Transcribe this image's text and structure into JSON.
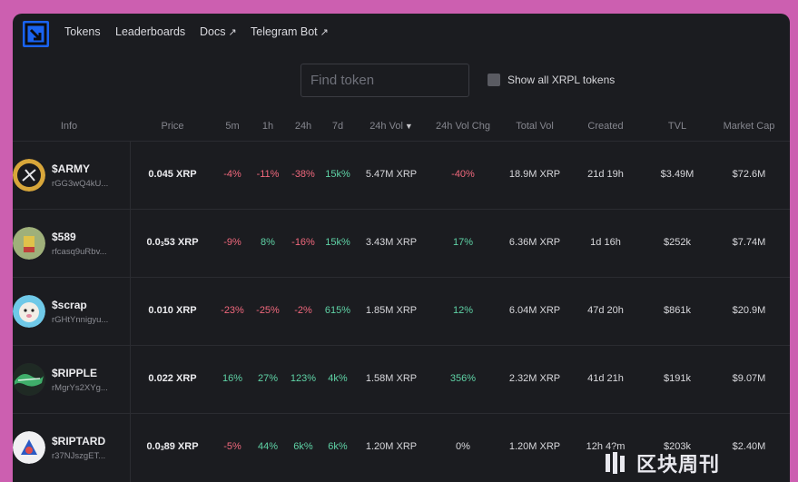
{
  "nav": {
    "items": [
      {
        "label": "Tokens",
        "external": false
      },
      {
        "label": "Leaderboards",
        "external": false
      },
      {
        "label": "Docs",
        "external": true
      },
      {
        "label": "Telegram Bot",
        "external": true
      }
    ],
    "external_icon": "↗"
  },
  "search": {
    "placeholder": "Find token",
    "value": ""
  },
  "toggle": {
    "label": "Show all XRPL tokens",
    "checked": false
  },
  "table": {
    "headers": [
      "Info",
      "Price",
      "5m",
      "1h",
      "24h",
      "7d",
      "24h Vol",
      "24h Vol Chg",
      "Total Vol",
      "Created",
      "TVL",
      "Market Cap"
    ],
    "sort_icon": "▼",
    "rows": [
      {
        "ticker": "$ARMY",
        "address": "rGG3wQ4kU...",
        "price": "0.045 XRP",
        "m5": "-4%",
        "h1": "-11%",
        "h24": "-38%",
        "d7": "15k%",
        "vol24": "5.47M XRP",
        "volchg": "-40%",
        "totalvol": "18.9M XRP",
        "created": "21d 19h",
        "tvl": "$3.49M",
        "mcap": "$72.6M"
      },
      {
        "ticker": "$589",
        "address": "rfcasq9uRbv...",
        "price_main": "0.0",
        "price_sub": "3",
        "price_rest": "53 XRP",
        "m5": "-9%",
        "h1": "8%",
        "h24": "-16%",
        "d7": "15k%",
        "vol24": "3.43M XRP",
        "volchg": "17%",
        "totalvol": "6.36M XRP",
        "created": "1d 16h",
        "tvl": "$252k",
        "mcap": "$7.74M"
      },
      {
        "ticker": "$scrap",
        "address": "rGHtYnnigyu...",
        "price": "0.010 XRP",
        "m5": "-23%",
        "h1": "-25%",
        "h24": "-2%",
        "d7": "615%",
        "vol24": "1.85M XRP",
        "volchg": "12%",
        "totalvol": "6.04M XRP",
        "created": "47d 20h",
        "tvl": "$861k",
        "mcap": "$20.9M"
      },
      {
        "ticker": "$RIPPLE",
        "address": "rMgrYs2XYg...",
        "price": "0.022 XRP",
        "m5": "16%",
        "h1": "27%",
        "h24": "123%",
        "d7": "4k%",
        "vol24": "1.58M XRP",
        "volchg": "356%",
        "totalvol": "2.32M XRP",
        "created": "41d 21h",
        "tvl": "$191k",
        "mcap": "$9.07M"
      },
      {
        "ticker": "$RIPTARD",
        "address": "r37NJszgET...",
        "price_main": "0.0",
        "price_sub": "3",
        "price_rest": "89 XRP",
        "m5": "-5%",
        "h1": "44%",
        "h24": "6k%",
        "d7": "6k%",
        "vol24": "1.20M XRP",
        "volchg": "0%",
        "totalvol": "1.20M XRP",
        "created": "12h 4?m",
        "tvl": "$203k",
        "mcap": "$2.40M"
      }
    ]
  },
  "colors": {
    "positive": "#5fd3a6",
    "negative": "#f0687c",
    "brand": "#1a63f0",
    "background": "#1b1c20"
  },
  "watermark": {
    "text": "区块周刊"
  }
}
